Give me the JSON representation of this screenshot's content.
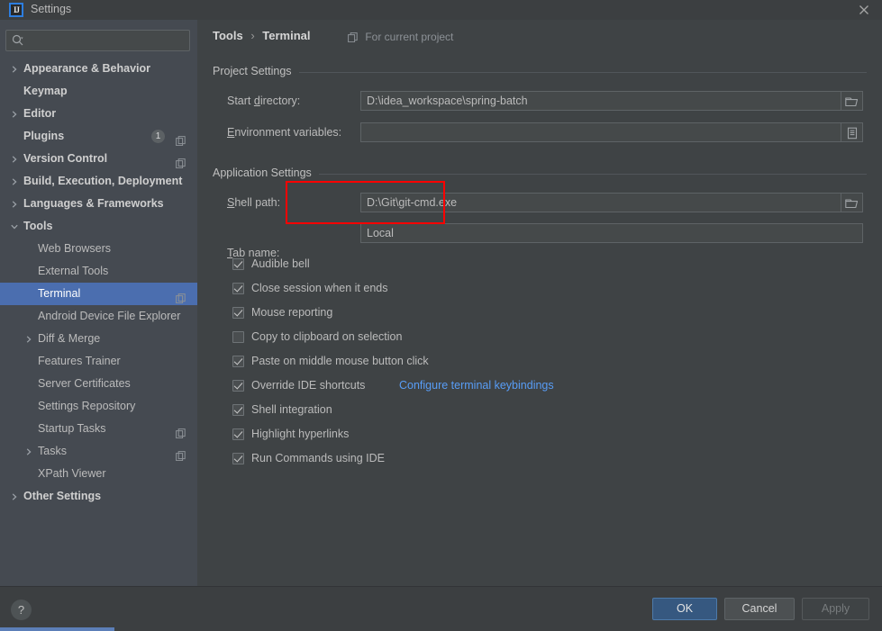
{
  "window": {
    "title": "Settings",
    "logo_text": "IJ",
    "close_icon": "close-icon"
  },
  "sidebar": {
    "search": {
      "placeholder": "",
      "value": "",
      "icon": "search-icon"
    },
    "items": [
      {
        "label": "Appearance & Behavior",
        "arrow": "right",
        "bold": true,
        "indent": 26,
        "badge": null,
        "project_icon": false,
        "selected": false
      },
      {
        "label": "Keymap",
        "arrow": "none",
        "bold": true,
        "indent": 26,
        "badge": null,
        "project_icon": false,
        "selected": false
      },
      {
        "label": "Editor",
        "arrow": "right",
        "bold": true,
        "indent": 26,
        "badge": null,
        "project_icon": false,
        "selected": false
      },
      {
        "label": "Plugins",
        "arrow": "none",
        "bold": true,
        "indent": 26,
        "badge": "1",
        "project_icon": true,
        "selected": false
      },
      {
        "label": "Version Control",
        "arrow": "right",
        "bold": true,
        "indent": 26,
        "badge": null,
        "project_icon": true,
        "selected": false
      },
      {
        "label": "Build, Execution, Deployment",
        "arrow": "right",
        "bold": true,
        "indent": 26,
        "badge": null,
        "project_icon": false,
        "selected": false
      },
      {
        "label": "Languages & Frameworks",
        "arrow": "right",
        "bold": true,
        "indent": 26,
        "badge": null,
        "project_icon": false,
        "selected": false
      },
      {
        "label": "Tools",
        "arrow": "down",
        "bold": true,
        "indent": 26,
        "badge": null,
        "project_icon": false,
        "selected": false
      },
      {
        "label": "Web Browsers",
        "arrow": "none",
        "bold": false,
        "indent": 42,
        "badge": null,
        "project_icon": false,
        "selected": false
      },
      {
        "label": "External Tools",
        "arrow": "none",
        "bold": false,
        "indent": 42,
        "badge": null,
        "project_icon": false,
        "selected": false
      },
      {
        "label": "Terminal",
        "arrow": "none",
        "bold": false,
        "indent": 42,
        "badge": null,
        "project_icon": true,
        "selected": true
      },
      {
        "label": "Android Device File Explorer",
        "arrow": "none",
        "bold": false,
        "indent": 42,
        "badge": null,
        "project_icon": false,
        "selected": false
      },
      {
        "label": "Diff & Merge",
        "arrow": "right",
        "bold": false,
        "indent": 42,
        "badge": null,
        "project_icon": false,
        "selected": false
      },
      {
        "label": "Features Trainer",
        "arrow": "none",
        "bold": false,
        "indent": 42,
        "badge": null,
        "project_icon": false,
        "selected": false
      },
      {
        "label": "Server Certificates",
        "arrow": "none",
        "bold": false,
        "indent": 42,
        "badge": null,
        "project_icon": false,
        "selected": false
      },
      {
        "label": "Settings Repository",
        "arrow": "none",
        "bold": false,
        "indent": 42,
        "badge": null,
        "project_icon": false,
        "selected": false
      },
      {
        "label": "Startup Tasks",
        "arrow": "none",
        "bold": false,
        "indent": 42,
        "badge": null,
        "project_icon": true,
        "selected": false
      },
      {
        "label": "Tasks",
        "arrow": "right",
        "bold": false,
        "indent": 42,
        "badge": null,
        "project_icon": true,
        "selected": false
      },
      {
        "label": "XPath Viewer",
        "arrow": "none",
        "bold": false,
        "indent": 42,
        "badge": null,
        "project_icon": false,
        "selected": false
      },
      {
        "label": "Other Settings",
        "arrow": "right",
        "bold": true,
        "indent": 26,
        "badge": null,
        "project_icon": false,
        "selected": false
      }
    ]
  },
  "main": {
    "breadcrumb": {
      "parent": "Tools",
      "separator": "›",
      "current": "Terminal"
    },
    "for_current_project": {
      "label": "For current project",
      "icon": "project-scope-icon"
    },
    "groups": {
      "project_settings": "Project Settings",
      "application_settings": "Application Settings"
    },
    "fields": {
      "start_directory": {
        "label_pre": "Start ",
        "label_mnemonic": "d",
        "label_post": "irectory:",
        "value": "D:\\idea_workspace\\spring-batch",
        "browse_icon": "folder-icon"
      },
      "environment_variables": {
        "label_pre": "",
        "label_mnemonic": "E",
        "label_post": "nvironment variables:",
        "value": "",
        "browse_icon": "list-icon"
      },
      "shell_path": {
        "label_pre": "",
        "label_mnemonic": "S",
        "label_post": "hell path:",
        "value": "D:\\Git\\git-cmd.exe",
        "browse_icon": "folder-icon"
      },
      "tab_name": {
        "label_pre": "",
        "label_mnemonic": "T",
        "label_post": "ab name:",
        "value": "Local",
        "browse_icon": null
      }
    },
    "checkboxes": [
      {
        "label": "Audible bell",
        "checked": true
      },
      {
        "label": "Close session when it ends",
        "checked": true
      },
      {
        "label": "Mouse reporting",
        "checked": true
      },
      {
        "label": "Copy to clipboard on selection",
        "checked": false
      },
      {
        "label": "Paste on middle mouse button click",
        "checked": true
      },
      {
        "label": "Override IDE shortcuts",
        "checked": true
      },
      {
        "label": "Shell integration",
        "checked": true
      },
      {
        "label": "Highlight hyperlinks",
        "checked": true
      },
      {
        "label": "Run Commands using IDE",
        "checked": true
      }
    ],
    "link": {
      "label": "Configure terminal keybindings"
    },
    "annotation": {
      "color": "#FF0000",
      "target": "shell-path-field"
    }
  },
  "footer": {
    "help_label": "?",
    "ok_label": "OK",
    "cancel_label": "Cancel",
    "apply_label": "Apply"
  },
  "colors": {
    "sidebar_bg": "#454A51",
    "panel_bg": "#3F4345",
    "selection": "#4B6EAF",
    "accent_link": "#589DF6",
    "ok_button": "#365880",
    "annotation": "#FF0000"
  }
}
